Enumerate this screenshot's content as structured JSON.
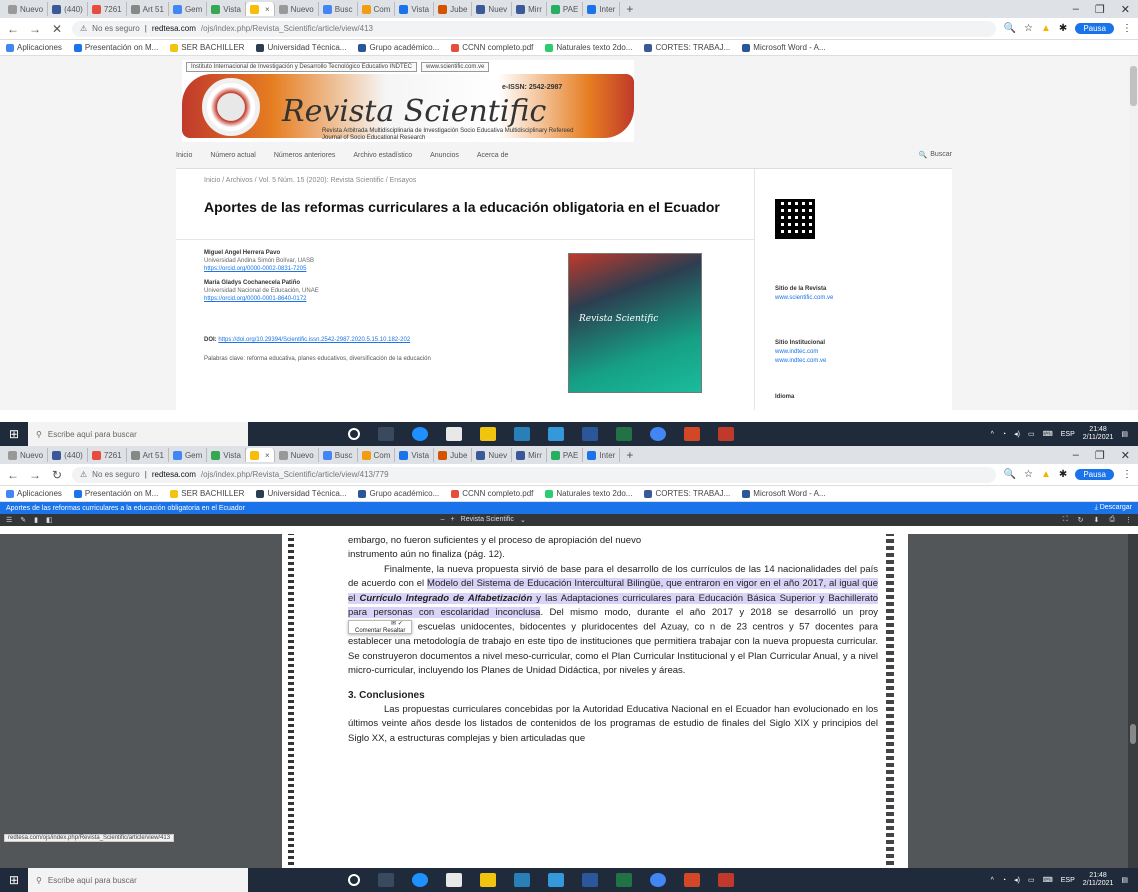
{
  "browser": {
    "tabs": [
      "Nuevo",
      "(440)",
      "7261",
      "Art 51",
      "Gem",
      "Vista",
      "",
      "Nuevo",
      "Busc",
      "Com",
      "Vista",
      "Jube",
      "Nuev",
      "Mirr",
      "PAE",
      "Inter"
    ],
    "tab_plus": "+",
    "window_controls": [
      "–",
      "❐",
      "✕"
    ],
    "bookmarks": [
      "Aplicaciones",
      "Presentación on M...",
      "SER BACHILLER",
      "Universidad Técnica...",
      "Grupo académico...",
      "CCNN completo.pdf",
      "Naturales texto 2do...",
      "CORTES: TRABAJ...",
      "Microsoft Word - A..."
    ],
    "pause_label": "Pausa",
    "not_secure": "No es seguro",
    "host": "redtesa.com",
    "colors": {
      "tabbar": "#dee1e6",
      "accent": "#1a73e8"
    }
  },
  "shot1": {
    "url_path": "/ojs/index.php/Revista_Scientific/article/view/413",
    "banner": {
      "institute": "Instituto Internacional de Investigación y Desarrollo Tecnológico Educativo INDTEC",
      "web": "www.scientific.com.ve",
      "title": "Revista Scientific",
      "issn": "e-ISSN: 2542-2987",
      "subtitle": "Revista Arbitrada Multidisciplinaria de Investigación Socio Educativa Multidisciplinary Refereed Journal of Socio Educational Research"
    },
    "nav": [
      "Inicio",
      "Número actual",
      "Números anteriores",
      "Archivo estadístico",
      "Anuncios",
      "Acerca de"
    ],
    "search_label": "Buscar",
    "breadcrumb": "Inicio / Archivos / Vol. 5 Núm. 15 (2020): Revista Scientific / Ensayos",
    "article_title": "Aportes de las reformas curriculares a la educación obligatoria en el Ecuador",
    "authors": [
      {
        "name": "Miguel Angel Herrera Pavo",
        "aff": "Universidad Andina Simón Bolívar, UASB",
        "orcid": "https://orcid.org/0000-0002-0831-7205"
      },
      {
        "name": "María Gladys Cochanecela Patiño",
        "aff": "Universidad Nacional de Educación, UNAE",
        "orcid": "https://orcid.org/0000-0001-8640-0172"
      }
    ],
    "doi_label": "DOI:",
    "doi": "https://doi.org/10.29394/Scientific.issn.2542-2987.2020.5.15.10.182-202",
    "keywords": "Palabras clave: reforma educativa, planes educativos, diversificación de la educación",
    "cover_label": "Revista Scientific",
    "sidebar": {
      "site_head": "Sitio de la Revista",
      "site_link": "www.scientific.com.ve",
      "inst_head": "Sitio Institucional",
      "inst_links": [
        "www.indtec.com",
        "www.indtec.com.ve"
      ],
      "idioma": "Idioma"
    }
  },
  "shot2": {
    "url_path": "/ojs/index.php/Revista_Scientific/article/view/413/779",
    "pdf_title": "Aportes de las reformas curriculares a la educación obligatoria en el Ecuador",
    "download_label": "Descargar",
    "pdf_toolbar_title": "Revista Scientific",
    "pdf_lines": {
      "l1": "embargo, no fueron suficientes y el proceso de apropiación del nuevo",
      "l2": "instrumento aún no finaliza (pág. 12).",
      "p2a": "Finalmente, la nueva propuesta sirvió de base para el desarrollo de los currículos de las 14 nacionalidades del país de acuerdo con el ",
      "p2b": "Modelo del Sistema de Educación Intercultural Bilingüe, que entraron en vigor en el año 2017, al igual que el ",
      "p2c": "Currículo Integrado de Alfabetización",
      "p2d": " y las Adaptaciones curriculares para Educación Básica Superior y Bachillerato para personas con escolaridad inconclusa",
      "p2e": ". Del mismo modo, durante el año 2017 y 2018 se desarrolló un proy",
      "p2f": "escuelas unidocentes, bidocentes y pluridocentes del Azuay, co",
      "p2g": "n de 23 centros y 57 docentes para establecer una metodología de trabajo en este tipo de instituciones que permitiera trabajar con la nueva propuesta curricular. Se construyeron documentos a nivel meso-curricular, como el Plan Curricular Institucional y el Plan Curricular Anual, y a nivel micro-curricular, incluyendo los Planes de Unidad Didáctica, por niveles y áreas.",
      "section": "3. Conclusiones",
      "p3": "Las propuestas curriculares concebidas por la Autoridad Educativa Nacional en el Ecuador han evolucionado en los últimos veinte años desde los listados de contenidos de los programas de estudio de finales del Siglo XIX y principios del Siglo XX, a estructuras complejas y bien articuladas que"
    },
    "popup_labels": [
      "Comentar",
      "Resaltar"
    ],
    "status_url": "redtesa.com/ojs/index.php/Revista_Scientific/article/view/413"
  },
  "taskbar": {
    "search_placeholder": "Escribe aquí para buscar",
    "lang": "ESP",
    "time": "21:48",
    "date": "2/11/2021",
    "icons": [
      "task-view-icon",
      "edge-icon",
      "store-icon",
      "folder-icon",
      "mail-icon",
      "onedrive-icon",
      "word-icon",
      "excel-icon",
      "chrome-icon",
      "powerpoint-icon",
      "photos-icon"
    ]
  }
}
